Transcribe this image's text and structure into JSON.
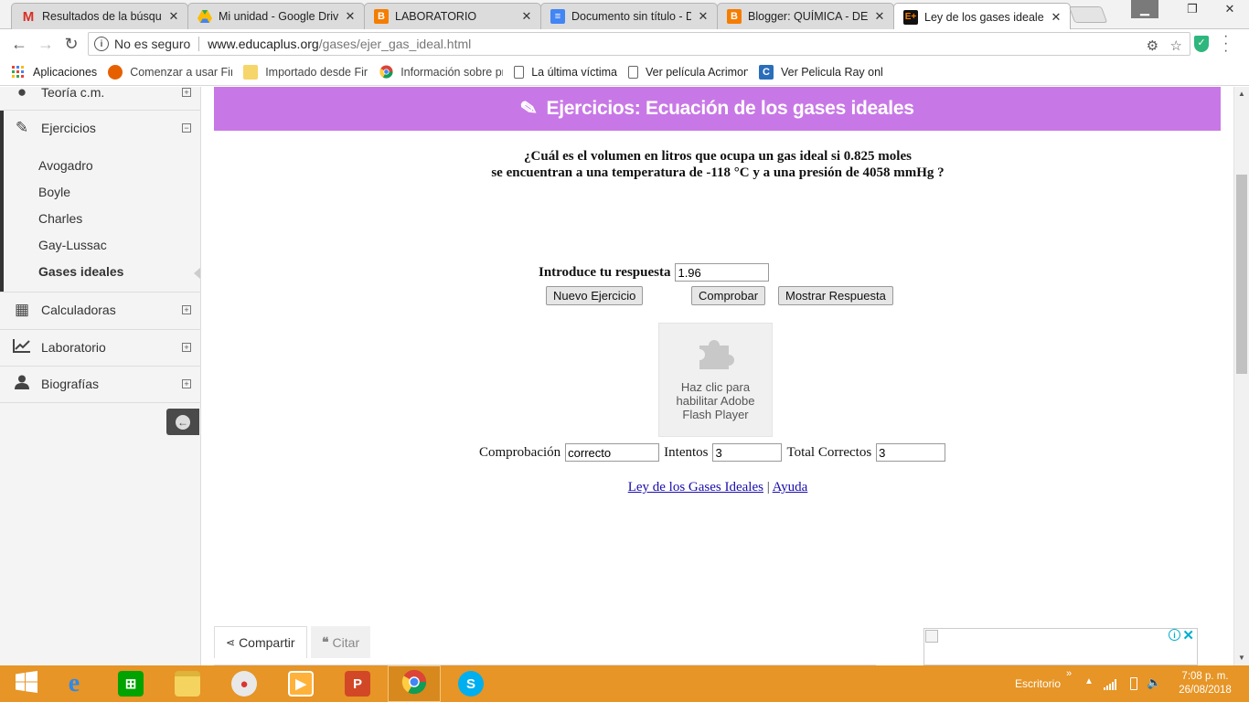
{
  "browser": {
    "tabs": [
      {
        "title": "Resultados de la búsqueda",
        "icon": "gmail-icon",
        "color": "#d93025",
        "active": false
      },
      {
        "title": "Mi unidad - Google Drive",
        "icon": "drive-icon",
        "color": "#34a853",
        "active": false
      },
      {
        "title": "LABORATORIO",
        "icon": "blogger-icon",
        "color": "#f57d00",
        "active": false
      },
      {
        "title": "Documento sin título - Doc",
        "icon": "docs-icon",
        "color": "#4285f4",
        "active": false
      },
      {
        "title": "Blogger: QUÍMICA - DECIMO",
        "icon": "blogger-icon",
        "color": "#f57d00",
        "active": false
      },
      {
        "title": "Ley de los gases ideales - ",
        "icon": "educaplus-icon",
        "color": "#111111",
        "active": true
      }
    ],
    "security_label": "No es seguro",
    "url_host": "www.educaplus.org",
    "url_path": "/gases/ejer_gas_ideal.html",
    "bookmarks": [
      {
        "label": "Aplicaciones",
        "icon": "apps-grid-icon"
      },
      {
        "label": "Comenzar a usar Firefox",
        "icon": "firefox-icon"
      },
      {
        "label": "Importado desde Firefox",
        "icon": "folder-icon"
      },
      {
        "label": "Información sobre precios",
        "icon": "chrome-icon"
      },
      {
        "label": "La última víctima",
        "icon": "page-icon"
      },
      {
        "label": "Ver película Acrimony",
        "icon": "page-icon"
      },
      {
        "label": "Ver Pelicula Ray online",
        "icon": "c-icon"
      }
    ]
  },
  "sidebar": {
    "sections": [
      {
        "label": "Teoría c.m.",
        "icon": "info-icon",
        "state": "collapsed"
      },
      {
        "label": "Ejercicios",
        "icon": "pencil-icon",
        "state": "expanded"
      },
      {
        "label": "Calculadoras",
        "icon": "calculator-icon",
        "state": "collapsed"
      },
      {
        "label": "Laboratorio",
        "icon": "chart-line-icon",
        "state": "collapsed"
      },
      {
        "label": "Biografías",
        "icon": "user-icon",
        "state": "collapsed"
      }
    ],
    "subitems": [
      "Avogadro",
      "Boyle",
      "Charles",
      "Gay-Lussac",
      "Gases ideales"
    ],
    "selected_subitem": "Gases ideales"
  },
  "main": {
    "banner_title": "Ejercicios: Ecuación de los gases ideales",
    "banner_color": "#c878e6",
    "question_line1": "¿Cuál es el volumen en litros que ocupa un gas ideal si 0.825 moles",
    "question_line2": "se encuentran a una temperatura de -118 °C y a una presión de 4058 mmHg ?",
    "answer_label": "Introduce tu respuesta",
    "answer_value": "1.96",
    "buttons": {
      "new": "Nuevo Ejercicio",
      "check": "Comprobar",
      "show": "Mostrar Respuesta"
    },
    "flash": {
      "line1": "Haz clic para",
      "line2": "habilitar Adobe",
      "line3": "Flash Player"
    },
    "check": {
      "label": "Comprobación",
      "value": "correcto",
      "tries_label": "Intentos",
      "tries_value": "3",
      "correct_label": "Total Correctos",
      "correct_value": "3"
    },
    "links": {
      "law": "Ley de los Gases Ideales",
      "sep": "|",
      "help": "Ayuda"
    },
    "share_tabs": {
      "share": "Compartir",
      "cite": "Citar"
    }
  },
  "taskbar": {
    "apps": [
      "windows-start-icon",
      "internet-explorer-icon",
      "store-icon",
      "file-explorer-icon",
      "paint-icon",
      "media-player-icon",
      "powerpoint-icon",
      "chrome-icon",
      "skype-icon"
    ],
    "desktop_label": "Escritorio",
    "time": "7:08 p. m.",
    "date": "26/08/2018",
    "color": "#e69526"
  }
}
